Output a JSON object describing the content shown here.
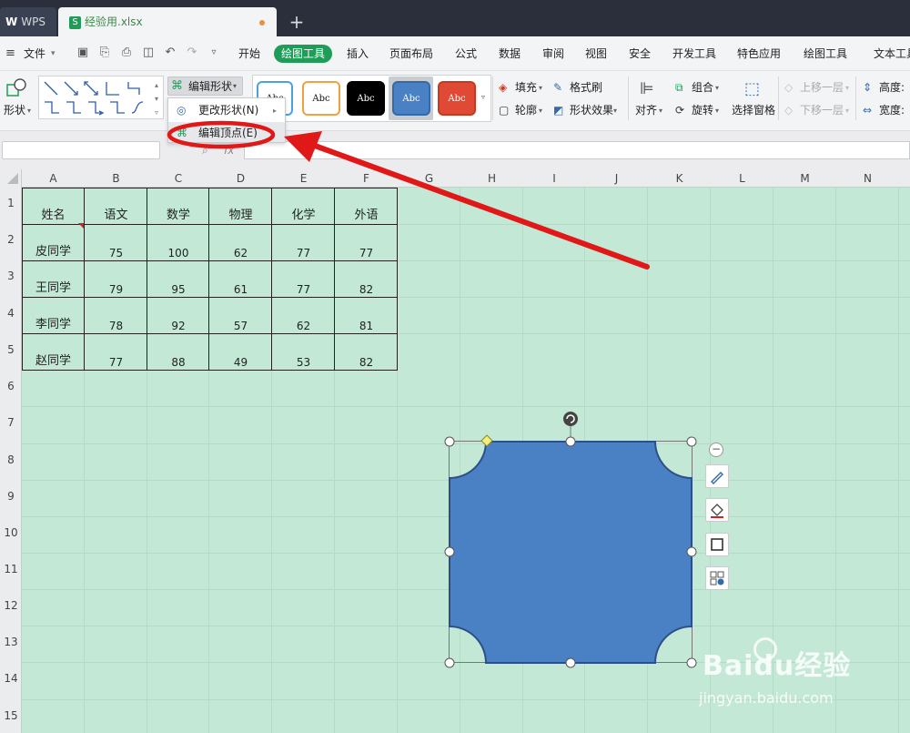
{
  "app": {
    "title_tab": "WPS",
    "file_tab": "经验用.xlsx",
    "new_tab_symbol": "+"
  },
  "menubar": {
    "file": "文件",
    "items": [
      "开始",
      "插入",
      "页面布局",
      "公式",
      "数据",
      "审阅",
      "视图",
      "安全",
      "开发工具",
      "特色应用",
      "绘图工具",
      "文本工具"
    ],
    "active": "绘图工具"
  },
  "ribbon": {
    "shape_label": "形状",
    "edit_shape": "编辑形状",
    "style_sample": "Abc",
    "fill": "填充",
    "format_painter": "格式刷",
    "outline": "轮廓",
    "shape_effects": "形状效果",
    "align": "对齐",
    "group": "组合",
    "rotate": "旋转",
    "selection_pane": "选择窗格",
    "bring_forward": "上移一层",
    "send_backward": "下移一层",
    "height": "高度:",
    "width": "宽度:"
  },
  "dropdown": {
    "change_shape": "更改形状(N)",
    "edit_points": "编辑顶点(E)"
  },
  "formula": {
    "fx": "fx"
  },
  "columns": [
    "A",
    "B",
    "C",
    "D",
    "E",
    "F",
    "G",
    "H",
    "I",
    "J",
    "K",
    "L",
    "M",
    "N"
  ],
  "rows": [
    "1",
    "2",
    "3",
    "4",
    "5",
    "6",
    "7",
    "8",
    "9",
    "10",
    "11",
    "12",
    "13",
    "14",
    "15"
  ],
  "table": {
    "headers": [
      "姓名",
      "语文",
      "数学",
      "物理",
      "化学",
      "外语"
    ],
    "rows": [
      [
        "皮同学",
        "75",
        "100",
        "62",
        "77",
        "77"
      ],
      [
        "王同学",
        "79",
        "95",
        "61",
        "77",
        "82"
      ],
      [
        "李同学",
        "78",
        "92",
        "57",
        "62",
        "81"
      ],
      [
        "赵同学",
        "77",
        "88",
        "49",
        "53",
        "82"
      ]
    ]
  },
  "watermark": {
    "brand": "Baidu经验",
    "url": "jingyan.baidu.com"
  },
  "colors": {
    "accent": "#1f9c58",
    "shape_fill": "#4a80c4",
    "sheet_bg": "#c3e8d6",
    "annotation": "#e01818"
  }
}
